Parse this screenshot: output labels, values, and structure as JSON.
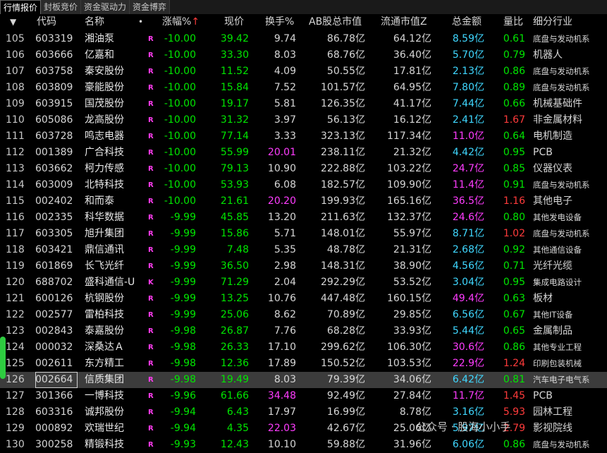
{
  "tabs": [
    "行情报价",
    "封板竞价",
    "资金驱动力",
    "资金博弈"
  ],
  "columns": {
    "expand": "▼",
    "code": "代码",
    "name": "名称",
    "dot": "•",
    "change": "涨幅%",
    "sort_arrow": "↑",
    "price": "现价",
    "turnover": "换手%",
    "ab_cap": "AB股总市值",
    "float_cap": "流通市值Z",
    "amount": "总金额",
    "vol_ratio": "量比",
    "industry": "细分行业"
  },
  "rows": [
    {
      "seq": "105",
      "code": "603319",
      "name": "湘油泵",
      "tag": "R",
      "change": "-10.00",
      "price": "39.42",
      "turnover": "9.74",
      "ab_cap": "86.78亿",
      "float_cap": "64.12亿",
      "amount": "8.59亿",
      "vol_ratio": "0.61",
      "industry": "底盘与发动机系"
    },
    {
      "seq": "106",
      "code": "603666",
      "name": "亿嘉和",
      "tag": "R",
      "change": "-10.00",
      "price": "33.30",
      "turnover": "8.03",
      "ab_cap": "68.76亿",
      "float_cap": "36.40亿",
      "amount": "5.70亿",
      "vol_ratio": "0.79",
      "industry": "机器人"
    },
    {
      "seq": "107",
      "code": "603758",
      "name": "秦安股份",
      "tag": "R",
      "change": "-10.00",
      "price": "11.52",
      "turnover": "4.09",
      "ab_cap": "50.55亿",
      "float_cap": "17.81亿",
      "amount": "2.13亿",
      "vol_ratio": "0.86",
      "industry": "底盘与发动机系"
    },
    {
      "seq": "108",
      "code": "603809",
      "name": "豪能股份",
      "tag": "R",
      "change": "-10.00",
      "price": "15.84",
      "turnover": "7.52",
      "ab_cap": "101.57亿",
      "float_cap": "64.95亿",
      "amount": "7.80亿",
      "vol_ratio": "0.89",
      "industry": "底盘与发动机系"
    },
    {
      "seq": "109",
      "code": "603915",
      "name": "国茂股份",
      "tag": "R",
      "change": "-10.00",
      "price": "19.17",
      "turnover": "5.81",
      "ab_cap": "126.35亿",
      "float_cap": "41.17亿",
      "amount": "7.44亿",
      "vol_ratio": "0.66",
      "industry": "机械基础件"
    },
    {
      "seq": "110",
      "code": "605086",
      "name": "龙高股份",
      "tag": "R",
      "change": "-10.00",
      "price": "31.32",
      "turnover": "3.97",
      "ab_cap": "56.13亿",
      "float_cap": "16.12亿",
      "amount": "2.41亿",
      "vol_ratio": "1.67",
      "industry": "非金属材料"
    },
    {
      "seq": "111",
      "code": "603728",
      "name": "鸣志电器",
      "tag": "R",
      "change": "-10.00",
      "price": "77.14",
      "turnover": "3.33",
      "ab_cap": "323.13亿",
      "float_cap": "117.34亿",
      "amount": "11.0亿",
      "vol_ratio": "0.64",
      "industry": "电机制造"
    },
    {
      "seq": "112",
      "code": "001389",
      "name": "广合科技",
      "tag": "R",
      "change": "-10.00",
      "price": "55.99",
      "turnover": "20.01",
      "ab_cap": "238.11亿",
      "float_cap": "21.32亿",
      "amount": "4.42亿",
      "vol_ratio": "0.95",
      "industry": "PCB"
    },
    {
      "seq": "113",
      "code": "603662",
      "name": "柯力传感",
      "tag": "R",
      "change": "-10.00",
      "price": "79.13",
      "turnover": "10.90",
      "ab_cap": "222.88亿",
      "float_cap": "103.22亿",
      "amount": "24.7亿",
      "vol_ratio": "0.85",
      "industry": "仪器仪表"
    },
    {
      "seq": "114",
      "code": "603009",
      "name": "北特科技",
      "tag": "R",
      "change": "-10.00",
      "price": "53.93",
      "turnover": "6.08",
      "ab_cap": "182.57亿",
      "float_cap": "109.90亿",
      "amount": "11.4亿",
      "vol_ratio": "0.91",
      "industry": "底盘与发动机系"
    },
    {
      "seq": "115",
      "code": "002402",
      "name": "和而泰",
      "tag": "R",
      "change": "-10.00",
      "price": "21.61",
      "turnover": "20.20",
      "ab_cap": "199.93亿",
      "float_cap": "165.16亿",
      "amount": "36.5亿",
      "vol_ratio": "1.16",
      "industry": "其他电子"
    },
    {
      "seq": "116",
      "code": "002335",
      "name": "科华数据",
      "tag": "R",
      "change": "-9.99",
      "price": "45.85",
      "turnover": "13.20",
      "ab_cap": "211.63亿",
      "float_cap": "132.37亿",
      "amount": "24.6亿",
      "vol_ratio": "0.80",
      "industry": "其他发电设备"
    },
    {
      "seq": "117",
      "code": "603305",
      "name": "旭升集团",
      "tag": "R",
      "change": "-9.99",
      "price": "15.86",
      "turnover": "5.71",
      "ab_cap": "148.01亿",
      "float_cap": "55.97亿",
      "amount": "8.71亿",
      "vol_ratio": "1.02",
      "industry": "底盘与发动机系"
    },
    {
      "seq": "118",
      "code": "603421",
      "name": "鼎信通讯",
      "tag": "R",
      "change": "-9.99",
      "price": "7.48",
      "turnover": "5.35",
      "ab_cap": "48.78亿",
      "float_cap": "21.31亿",
      "amount": "2.68亿",
      "vol_ratio": "0.92",
      "industry": "其他通信设备"
    },
    {
      "seq": "119",
      "code": "601869",
      "name": "长飞光纤",
      "tag": "R",
      "change": "-9.99",
      "price": "36.50",
      "turnover": "2.98",
      "ab_cap": "148.31亿",
      "float_cap": "38.90亿",
      "amount": "4.56亿",
      "vol_ratio": "0.71",
      "industry": "光纤光缆"
    },
    {
      "seq": "120",
      "code": "688702",
      "name": "盛科通信-U",
      "tag": "K",
      "change": "-9.99",
      "price": "71.29",
      "turnover": "2.04",
      "ab_cap": "292.29亿",
      "float_cap": "53.52亿",
      "amount": "3.04亿",
      "vol_ratio": "0.95",
      "industry": "集成电路设计"
    },
    {
      "seq": "121",
      "code": "600126",
      "name": "杭钢股份",
      "tag": "R",
      "change": "-9.99",
      "price": "13.25",
      "turnover": "10.76",
      "ab_cap": "447.48亿",
      "float_cap": "160.15亿",
      "amount": "49.4亿",
      "vol_ratio": "0.63",
      "industry": "板材"
    },
    {
      "seq": "122",
      "code": "002577",
      "name": "雷柏科技",
      "tag": "R",
      "change": "-9.99",
      "price": "25.06",
      "turnover": "8.62",
      "ab_cap": "70.89亿",
      "float_cap": "29.85亿",
      "amount": "6.56亿",
      "vol_ratio": "0.67",
      "industry": "其他IT设备"
    },
    {
      "seq": "123",
      "code": "002843",
      "name": "泰嘉股份",
      "tag": "R",
      "change": "-9.98",
      "price": "26.87",
      "turnover": "7.76",
      "ab_cap": "68.28亿",
      "float_cap": "33.93亿",
      "amount": "5.44亿",
      "vol_ratio": "0.65",
      "industry": "金属制品"
    },
    {
      "seq": "124",
      "code": "000032",
      "name": "深桑达Ａ",
      "tag": "R",
      "change": "-9.98",
      "price": "26.33",
      "turnover": "17.10",
      "ab_cap": "299.62亿",
      "float_cap": "106.30亿",
      "amount": "30.6亿",
      "vol_ratio": "0.86",
      "industry": "其他专业工程"
    },
    {
      "seq": "125",
      "code": "002611",
      "name": "东方精工",
      "tag": "R",
      "change": "-9.98",
      "price": "12.36",
      "turnover": "17.89",
      "ab_cap": "150.52亿",
      "float_cap": "103.53亿",
      "amount": "22.9亿",
      "vol_ratio": "1.24",
      "industry": "印刷包装机械"
    },
    {
      "seq": "126",
      "code": "002664",
      "name": "信质集团",
      "tag": "R",
      "change": "-9.98",
      "price": "19.49",
      "turnover": "8.03",
      "ab_cap": "79.39亿",
      "float_cap": "34.06亿",
      "amount": "6.42亿",
      "vol_ratio": "0.81",
      "industry": "汽车电子电气系"
    },
    {
      "seq": "127",
      "code": "301366",
      "name": "一博科技",
      "tag": "R",
      "change": "-9.96",
      "price": "61.66",
      "turnover": "34.48",
      "ab_cap": "92.49亿",
      "float_cap": "27.84亿",
      "amount": "11.7亿",
      "vol_ratio": "1.45",
      "industry": "PCB"
    },
    {
      "seq": "128",
      "code": "603316",
      "name": "诚邦股份",
      "tag": "R",
      "change": "-9.94",
      "price": "6.43",
      "turnover": "17.97",
      "ab_cap": "16.99亿",
      "float_cap": "8.78亿",
      "amount": "3.16亿",
      "vol_ratio": "5.93",
      "industry": "园林工程"
    },
    {
      "seq": "129",
      "code": "000892",
      "name": "欢瑞世纪",
      "tag": "R",
      "change": "-9.94",
      "price": "4.35",
      "turnover": "22.03",
      "ab_cap": "42.67亿",
      "float_cap": "25.06亿",
      "amount": "5.97亿",
      "vol_ratio": "2.79",
      "industry": "影视院线"
    },
    {
      "seq": "130",
      "code": "300258",
      "name": "精锻科技",
      "tag": "R",
      "change": "-9.93",
      "price": "12.43",
      "turnover": "10.10",
      "ab_cap": "59.88亿",
      "float_cap": "31.96亿",
      "amount": "6.06亿",
      "vol_ratio": "0.86",
      "industry": "底盘与发动机系"
    }
  ],
  "selected_row": "126",
  "watermark": "公众号 · 股海小小手",
  "colors": {
    "down": "#00e600",
    "up": "#ff3b3b",
    "highlight": "#ff3cff",
    "amount": "#3fd7ff",
    "background": "#000000"
  }
}
